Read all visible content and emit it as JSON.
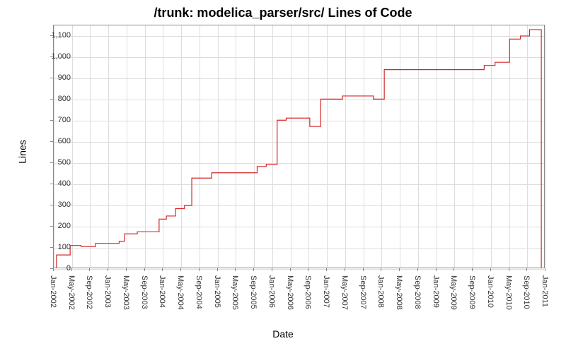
{
  "chart_data": {
    "type": "line",
    "title": "/trunk: modelica_parser/src/ Lines of Code",
    "xlabel": "Date",
    "ylabel": "Lines",
    "ylim": [
      0,
      1150
    ],
    "line_color": "#d62728",
    "x_ticks": [
      "Jan-2002",
      "May-2002",
      "Sep-2002",
      "Jan-2003",
      "May-2003",
      "Sep-2003",
      "Jan-2004",
      "May-2004",
      "Sep-2004",
      "Jan-2005",
      "May-2005",
      "Sep-2005",
      "Jan-2006",
      "May-2006",
      "Sep-2006",
      "Jan-2007",
      "May-2007",
      "Sep-2007",
      "Jan-2008",
      "May-2008",
      "Sep-2008",
      "Jan-2009",
      "May-2009",
      "Sep-2009",
      "Jan-2010",
      "May-2010",
      "Sep-2010",
      "Jan-2011"
    ],
    "y_ticks": [
      0,
      100,
      200,
      300,
      400,
      500,
      600,
      700,
      800,
      900,
      1000,
      1100
    ],
    "series": [
      {
        "name": "Lines of Code",
        "points": [
          {
            "xi": 0.15,
            "y": 0
          },
          {
            "xi": 0.15,
            "y": 60
          },
          {
            "xi": 0.9,
            "y": 60
          },
          {
            "xi": 0.9,
            "y": 105
          },
          {
            "xi": 1.5,
            "y": 105
          },
          {
            "xi": 1.5,
            "y": 100
          },
          {
            "xi": 2.3,
            "y": 100
          },
          {
            "xi": 2.3,
            "y": 115
          },
          {
            "xi": 3.6,
            "y": 115
          },
          {
            "xi": 3.6,
            "y": 125
          },
          {
            "xi": 3.9,
            "y": 125
          },
          {
            "xi": 3.9,
            "y": 160
          },
          {
            "xi": 4.6,
            "y": 160
          },
          {
            "xi": 4.6,
            "y": 170
          },
          {
            "xi": 5.8,
            "y": 170
          },
          {
            "xi": 5.8,
            "y": 230
          },
          {
            "xi": 6.2,
            "y": 230
          },
          {
            "xi": 6.2,
            "y": 245
          },
          {
            "xi": 6.7,
            "y": 245
          },
          {
            "xi": 6.7,
            "y": 280
          },
          {
            "xi": 7.2,
            "y": 280
          },
          {
            "xi": 7.2,
            "y": 295
          },
          {
            "xi": 7.6,
            "y": 295
          },
          {
            "xi": 7.6,
            "y": 425
          },
          {
            "xi": 8.7,
            "y": 425
          },
          {
            "xi": 8.7,
            "y": 450
          },
          {
            "xi": 11.2,
            "y": 450
          },
          {
            "xi": 11.2,
            "y": 480
          },
          {
            "xi": 11.7,
            "y": 480
          },
          {
            "xi": 11.7,
            "y": 490
          },
          {
            "xi": 12.3,
            "y": 490
          },
          {
            "xi": 12.3,
            "y": 700
          },
          {
            "xi": 12.8,
            "y": 700
          },
          {
            "xi": 12.8,
            "y": 710
          },
          {
            "xi": 14.1,
            "y": 710
          },
          {
            "xi": 14.1,
            "y": 670
          },
          {
            "xi": 14.7,
            "y": 670
          },
          {
            "xi": 14.7,
            "y": 800
          },
          {
            "xi": 15.9,
            "y": 800
          },
          {
            "xi": 15.9,
            "y": 815
          },
          {
            "xi": 17.6,
            "y": 815
          },
          {
            "xi": 17.6,
            "y": 800
          },
          {
            "xi": 18.2,
            "y": 800
          },
          {
            "xi": 18.2,
            "y": 940
          },
          {
            "xi": 23.7,
            "y": 940
          },
          {
            "xi": 23.7,
            "y": 960
          },
          {
            "xi": 24.3,
            "y": 960
          },
          {
            "xi": 24.3,
            "y": 975
          },
          {
            "xi": 25.1,
            "y": 975
          },
          {
            "xi": 25.1,
            "y": 1085
          },
          {
            "xi": 25.7,
            "y": 1085
          },
          {
            "xi": 25.7,
            "y": 1100
          },
          {
            "xi": 26.2,
            "y": 1100
          },
          {
            "xi": 26.2,
            "y": 1130
          },
          {
            "xi": 26.85,
            "y": 1130
          },
          {
            "xi": 26.85,
            "y": 0
          }
        ]
      }
    ]
  }
}
